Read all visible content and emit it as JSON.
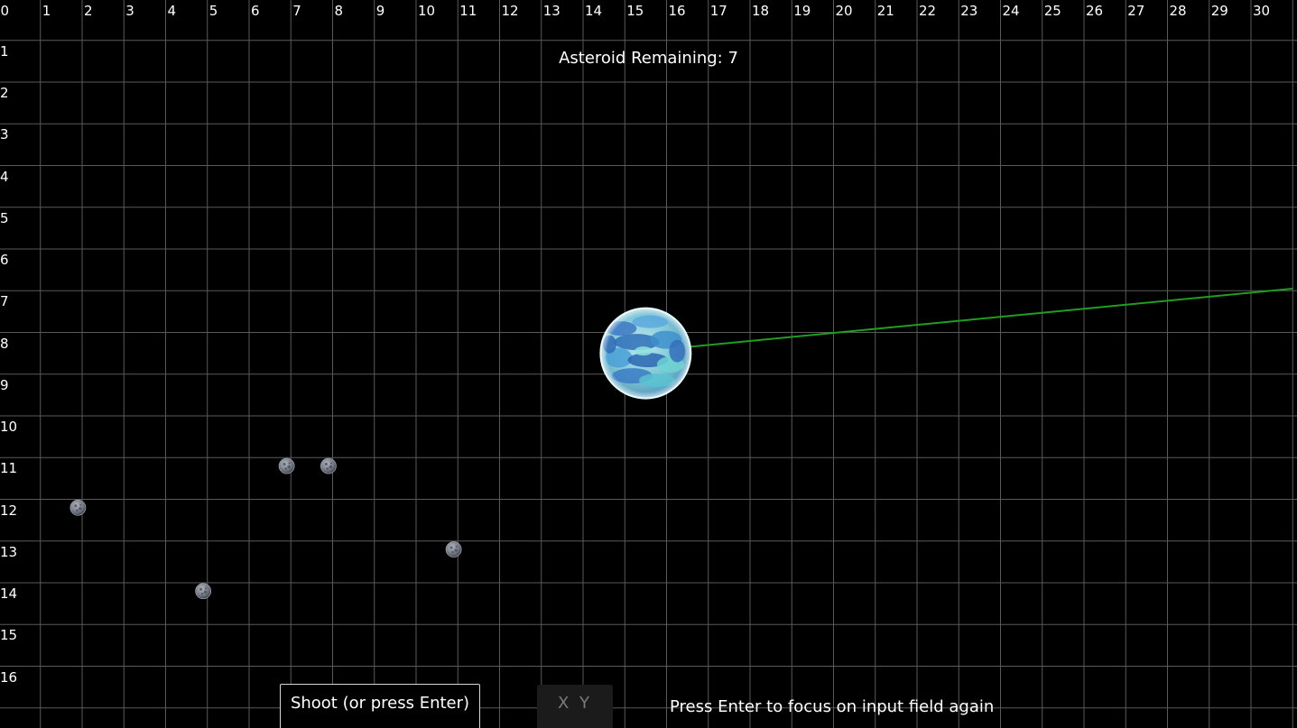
{
  "grid": {
    "x_labels": [
      "0",
      "1",
      "2",
      "3",
      "4",
      "5",
      "6",
      "7",
      "8",
      "9",
      "10",
      "11",
      "12",
      "13",
      "14",
      "15",
      "16",
      "17",
      "18",
      "19",
      "20",
      "21",
      "22",
      "23",
      "24",
      "25",
      "26",
      "27",
      "28",
      "29",
      "30"
    ],
    "y_labels": [
      "1",
      "2",
      "3",
      "4",
      "5",
      "6",
      "7",
      "8",
      "9",
      "10",
      "11",
      "12",
      "13",
      "14",
      "15",
      "16"
    ],
    "line_color": "#5a5a5a",
    "background": "#000000"
  },
  "hud": {
    "asteroid_counter": "Asteroid Remaining: 7",
    "hint": "Press Enter to focus on input field again"
  },
  "controls": {
    "shoot_label": "Shoot (or press Enter)",
    "coord_placeholder": "X Y",
    "coord_value": ""
  },
  "scene": {
    "planet": {
      "x": 15.5,
      "y": 8.5,
      "radius_units": 1.08,
      "icon": "planet-icon"
    },
    "laser": {
      "from": [
        16.5,
        8.35
      ],
      "to": [
        31,
        6.95
      ],
      "color": "#1f9e1f"
    },
    "asteroids": [
      {
        "x": 1.9,
        "y": 12.2,
        "icon": "asteroid-icon"
      },
      {
        "x": 6.9,
        "y": 11.2,
        "icon": "asteroid-icon"
      },
      {
        "x": 7.9,
        "y": 11.2,
        "icon": "asteroid-icon"
      },
      {
        "x": 10.9,
        "y": 13.2,
        "icon": "asteroid-icon"
      },
      {
        "x": 4.9,
        "y": 14.2,
        "icon": "asteroid-icon"
      }
    ]
  }
}
